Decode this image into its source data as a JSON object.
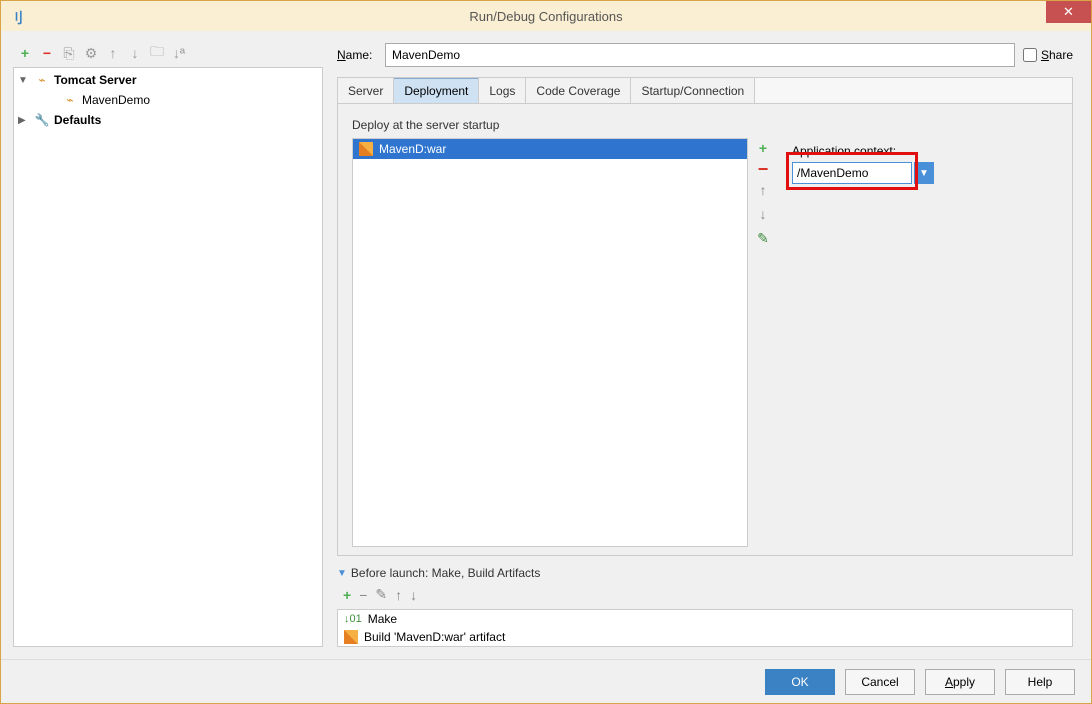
{
  "window": {
    "title": "Run/Debug Configurations"
  },
  "tree": {
    "node1": "Tomcat Server",
    "node1_child": "MavenDemo",
    "node2": "Defaults"
  },
  "form": {
    "name_label": "Name:",
    "name_value": "MavenDemo",
    "share_label": "Share"
  },
  "tabs": {
    "t0": "Server",
    "t1": "Deployment",
    "t2": "Logs",
    "t3": "Code Coverage",
    "t4": "Startup/Connection"
  },
  "deployment": {
    "section_label": "Deploy at the server startup",
    "artifact": "MavenD:war",
    "app_ctx_label": "Application context:",
    "app_ctx_value": "/MavenDemo"
  },
  "before_launch": {
    "header": "Before launch: Make, Build Artifacts",
    "item1": "Make",
    "item2": "Build 'MavenD:war' artifact"
  },
  "buttons": {
    "ok": "OK",
    "cancel": "Cancel",
    "apply": "Apply",
    "help": "Help"
  }
}
